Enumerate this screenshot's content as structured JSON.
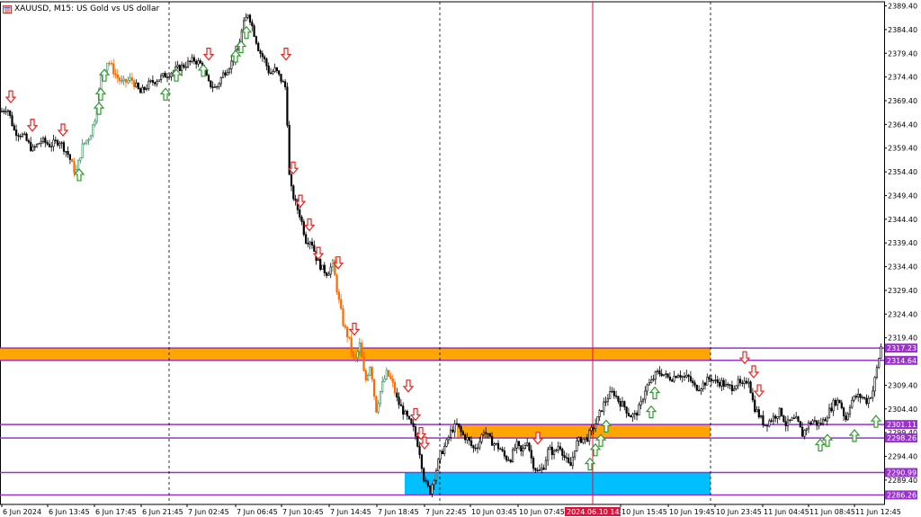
{
  "window": {
    "symbol_title": "XAUUSD, M15:  US Gold vs US dollar"
  },
  "colors": {
    "background": "#ffffff",
    "candle": "#000000",
    "bull_highlight": "#2e8b57",
    "bear_highlight": "#ff6a00",
    "zone_orange": "#ffa500",
    "zone_blue": "#00bfff",
    "level_line": "#9932cc",
    "cursor_line": "#dc143c",
    "up_arrow": "#2e9b2e",
    "down_arrow": "#e8231e"
  },
  "chart_data": {
    "type": "candlestick",
    "ylim": [
      2284.26,
      2390.26
    ],
    "y_ticks": [
      "2389.40",
      "2384.40",
      "2379.40",
      "2374.40",
      "2369.40",
      "2364.40",
      "2359.40",
      "2354.40",
      "2349.40",
      "2344.40",
      "2339.40",
      "2334.40",
      "2329.40",
      "2324.40",
      "2319.40",
      "2309.40",
      "2304.40",
      "2299.40",
      "2294.40",
      "2289.40"
    ],
    "x_ticks": [
      "6 Jun 2024",
      "6 Jun 13:45",
      "6 Jun 17:45",
      "6 Jun 21:45",
      "7 Jun 02:45",
      "7 Jun 06:45",
      "7 Jun 10:45",
      "7 Jun 14:45",
      "7 Jun 18:45",
      "7 Jun 22:45",
      "10 Jun 03:45",
      "10 Jun 07:45",
      "2024.06.10 14:00",
      "10 Jun 15:45",
      "10 Jun 19:45",
      "10 Jun 23:45",
      "11 Jun 04:45",
      "11 Jun 08:45",
      "11 Jun 12:45"
    ],
    "cursor_time_label": "2024.06.10 14:00",
    "price_levels": [
      {
        "price": 2317.23,
        "label": "2317.23",
        "color": "#9932cc"
      },
      {
        "price": 2314.64,
        "label": "2314.64",
        "color": "#9932cc"
      },
      {
        "price": 2301.11,
        "label": "2301.11",
        "color": "#9932cc"
      },
      {
        "price": 2298.26,
        "label": "2298.26",
        "color": "#9932cc"
      },
      {
        "price": 2290.99,
        "label": "2290.99",
        "color": "#9932cc"
      },
      {
        "price": 2286.26,
        "label": "2286.26",
        "color": "#9932cc"
      }
    ],
    "zones": [
      {
        "from_price": 2314.64,
        "to_price": 2317.23,
        "color": "#ffa500"
      },
      {
        "from_price": 2298.26,
        "to_price": 2301.11,
        "color": "#ffa500"
      },
      {
        "from_price": 2286.26,
        "to_price": 2290.99,
        "color": "#00bfff"
      }
    ],
    "path": [
      [
        0,
        2367
      ],
      [
        8,
        2368
      ],
      [
        16,
        2363
      ],
      [
        26,
        2362
      ],
      [
        36,
        2359
      ],
      [
        46,
        2361
      ],
      [
        56,
        2360
      ],
      [
        66,
        2361
      ],
      [
        76,
        2358
      ],
      [
        84,
        2354
      ],
      [
        92,
        2360
      ],
      [
        100,
        2362
      ],
      [
        106,
        2366
      ],
      [
        112,
        2374
      ],
      [
        120,
        2378
      ],
      [
        128,
        2375
      ],
      [
        136,
        2373
      ],
      [
        146,
        2374
      ],
      [
        156,
        2371
      ],
      [
        166,
        2373
      ],
      [
        176,
        2374
      ],
      [
        186,
        2375
      ],
      [
        196,
        2376
      ],
      [
        206,
        2377
      ],
      [
        216,
        2378
      ],
      [
        224,
        2377
      ],
      [
        232,
        2373
      ],
      [
        240,
        2372
      ],
      [
        248,
        2375
      ],
      [
        256,
        2377
      ],
      [
        264,
        2380
      ],
      [
        270,
        2385
      ],
      [
        276,
        2388
      ],
      [
        282,
        2384
      ],
      [
        288,
        2380
      ],
      [
        294,
        2378
      ],
      [
        300,
        2375
      ],
      [
        306,
        2376
      ],
      [
        312,
        2374
      ],
      [
        318,
        2372
      ],
      [
        322,
        2352
      ],
      [
        328,
        2348
      ],
      [
        334,
        2345
      ],
      [
        340,
        2340
      ],
      [
        346,
        2340
      ],
      [
        352,
        2336
      ],
      [
        358,
        2334
      ],
      [
        364,
        2333
      ],
      [
        370,
        2335
      ],
      [
        376,
        2328
      ],
      [
        382,
        2322
      ],
      [
        388,
        2319
      ],
      [
        394,
        2314
      ],
      [
        400,
        2318
      ],
      [
        406,
        2310
      ],
      [
        412,
        2314
      ],
      [
        418,
        2304
      ],
      [
        424,
        2309
      ],
      [
        430,
        2312
      ],
      [
        436,
        2310
      ],
      [
        442,
        2306
      ],
      [
        448,
        2304
      ],
      [
        454,
        2302
      ],
      [
        460,
        2300
      ],
      [
        466,
        2296
      ],
      [
        472,
        2289
      ],
      [
        478,
        2287
      ],
      [
        484,
        2291
      ],
      [
        490,
        2295
      ],
      [
        496,
        2297
      ],
      [
        502,
        2300
      ],
      [
        508,
        2301
      ],
      [
        514,
        2299
      ],
      [
        520,
        2298
      ],
      [
        526,
        2296
      ],
      [
        532,
        2297
      ],
      [
        538,
        2300
      ],
      [
        544,
        2298
      ],
      [
        550,
        2297
      ],
      [
        556,
        2296
      ],
      [
        562,
        2294
      ],
      [
        568,
        2294
      ],
      [
        574,
        2297
      ],
      [
        580,
        2295
      ],
      [
        586,
        2298
      ],
      [
        592,
        2293
      ],
      [
        598,
        2291
      ],
      [
        604,
        2292
      ],
      [
        610,
        2296
      ],
      [
        616,
        2295
      ],
      [
        622,
        2297
      ],
      [
        628,
        2294
      ],
      [
        634,
        2292
      ],
      [
        640,
        2297
      ],
      [
        646,
        2298
      ],
      [
        652,
        2298
      ],
      [
        658,
        2300
      ],
      [
        664,
        2302
      ],
      [
        670,
        2305
      ],
      [
        676,
        2307
      ],
      [
        682,
        2308
      ],
      [
        688,
        2306
      ],
      [
        694,
        2305
      ],
      [
        700,
        2303
      ],
      [
        706,
        2303
      ],
      [
        712,
        2305
      ],
      [
        718,
        2309
      ],
      [
        724,
        2310
      ],
      [
        730,
        2312
      ],
      [
        736,
        2312
      ],
      [
        742,
        2311
      ],
      [
        748,
        2311
      ],
      [
        754,
        2312
      ],
      [
        760,
        2311
      ],
      [
        766,
        2311
      ],
      [
        772,
        2309
      ],
      [
        778,
        2309
      ],
      [
        784,
        2310
      ],
      [
        790,
        2311
      ],
      [
        796,
        2310
      ],
      [
        802,
        2310
      ],
      [
        808,
        2309
      ],
      [
        814,
        2309
      ],
      [
        820,
        2310
      ],
      [
        826,
        2309
      ],
      [
        832,
        2311
      ],
      [
        838,
        2305
      ],
      [
        844,
        2303
      ],
      [
        850,
        2301
      ],
      [
        856,
        2302
      ],
      [
        862,
        2303
      ],
      [
        868,
        2304
      ],
      [
        874,
        2301
      ],
      [
        880,
        2302
      ],
      [
        886,
        2302
      ],
      [
        892,
        2299
      ],
      [
        898,
        2301
      ],
      [
        904,
        2302
      ],
      [
        910,
        2301
      ],
      [
        916,
        2302
      ],
      [
        922,
        2304
      ],
      [
        928,
        2306
      ],
      [
        934,
        2306
      ],
      [
        940,
        2302
      ],
      [
        946,
        2306
      ],
      [
        952,
        2307
      ],
      [
        958,
        2307
      ],
      [
        964,
        2306
      ],
      [
        970,
        2308
      ],
      [
        976,
        2314
      ],
      [
        980,
        2318
      ]
    ],
    "signals_up": [
      [
        88,
        2355
      ],
      [
        110,
        2369
      ],
      [
        112,
        2372
      ],
      [
        116,
        2376
      ],
      [
        184,
        2372
      ],
      [
        196,
        2376
      ],
      [
        226,
        2377
      ],
      [
        262,
        2380
      ],
      [
        268,
        2382
      ],
      [
        274,
        2385
      ],
      [
        656,
        2294
      ],
      [
        662,
        2297
      ],
      [
        668,
        2299
      ],
      [
        674,
        2302
      ],
      [
        724,
        2305
      ],
      [
        728,
        2309
      ],
      [
        912,
        2298
      ],
      [
        920,
        2299
      ],
      [
        950,
        2300
      ],
      [
        974,
        2303
      ]
    ],
    "signals_down": [
      [
        12,
        2369
      ],
      [
        36,
        2363
      ],
      [
        70,
        2362
      ],
      [
        232,
        2378
      ],
      [
        318,
        2378
      ],
      [
        326,
        2354
      ],
      [
        334,
        2347
      ],
      [
        344,
        2342
      ],
      [
        354,
        2336
      ],
      [
        376,
        2334
      ],
      [
        394,
        2320
      ],
      [
        454,
        2308
      ],
      [
        462,
        2302
      ],
      [
        468,
        2298
      ],
      [
        472,
        2296
      ],
      [
        598,
        2297
      ],
      [
        828,
        2314
      ],
      [
        838,
        2311
      ],
      [
        844,
        2307
      ]
    ]
  }
}
